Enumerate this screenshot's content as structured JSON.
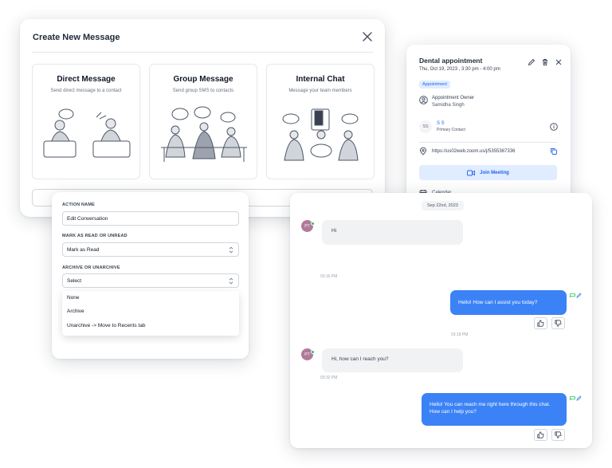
{
  "create_message": {
    "title": "Create New Message",
    "options": [
      {
        "title": "Direct Message",
        "desc": "Send direct message to a contact"
      },
      {
        "title": "Group Message",
        "desc": "Send group SMS to contacts"
      },
      {
        "title": "Internal Chat",
        "desc": "Message your team members"
      }
    ]
  },
  "appointment": {
    "title": "Dental appointment",
    "time": "Thu, Oct 19, 2023 , 3:30 pm - 4:00 pm",
    "badge": "Appointment",
    "owner_label": "Appointment Owner",
    "owner_name": "Samidha Singh",
    "contact_initials": "SS",
    "contact_name": "S S",
    "contact_role": "Primary Contact",
    "link": "https://us02web.zoom.us/j/5355367336",
    "join_label": "Join Meeting",
    "calendar_label": "Calendar"
  },
  "action_form": {
    "action_name_label": "ACTION NAME",
    "action_name_value": "Edit Conversation",
    "read_label": "MARK AS READ OR UNREAD",
    "read_value": "Mark as Read",
    "archive_label": "ARCHIVE OR UNARCHIVE",
    "archive_value": "Select",
    "archive_options": [
      "None",
      "Archive",
      "Unarchive -> Move to Recents tab"
    ]
  },
  "chat": {
    "date": "Sep 22nd, 2023",
    "avatar_initials": "PT",
    "messages": [
      {
        "dir": "in",
        "text": "Hi",
        "time": "03:16 PM"
      },
      {
        "dir": "out",
        "text": "Hello! How can I assist you today?",
        "time": "03:18 PM"
      },
      {
        "dir": "in",
        "text": "Hi, how can I reach you?",
        "time": "03:32 PM"
      },
      {
        "dir": "out",
        "text": "Hello! You can reach me right here through this chat. How can I help you?",
        "time": ""
      }
    ]
  },
  "colors": {
    "accent": "#3b82f6",
    "accent_light": "#e0ecff",
    "online": "#22c55e",
    "avatar": "#b07a9a"
  }
}
